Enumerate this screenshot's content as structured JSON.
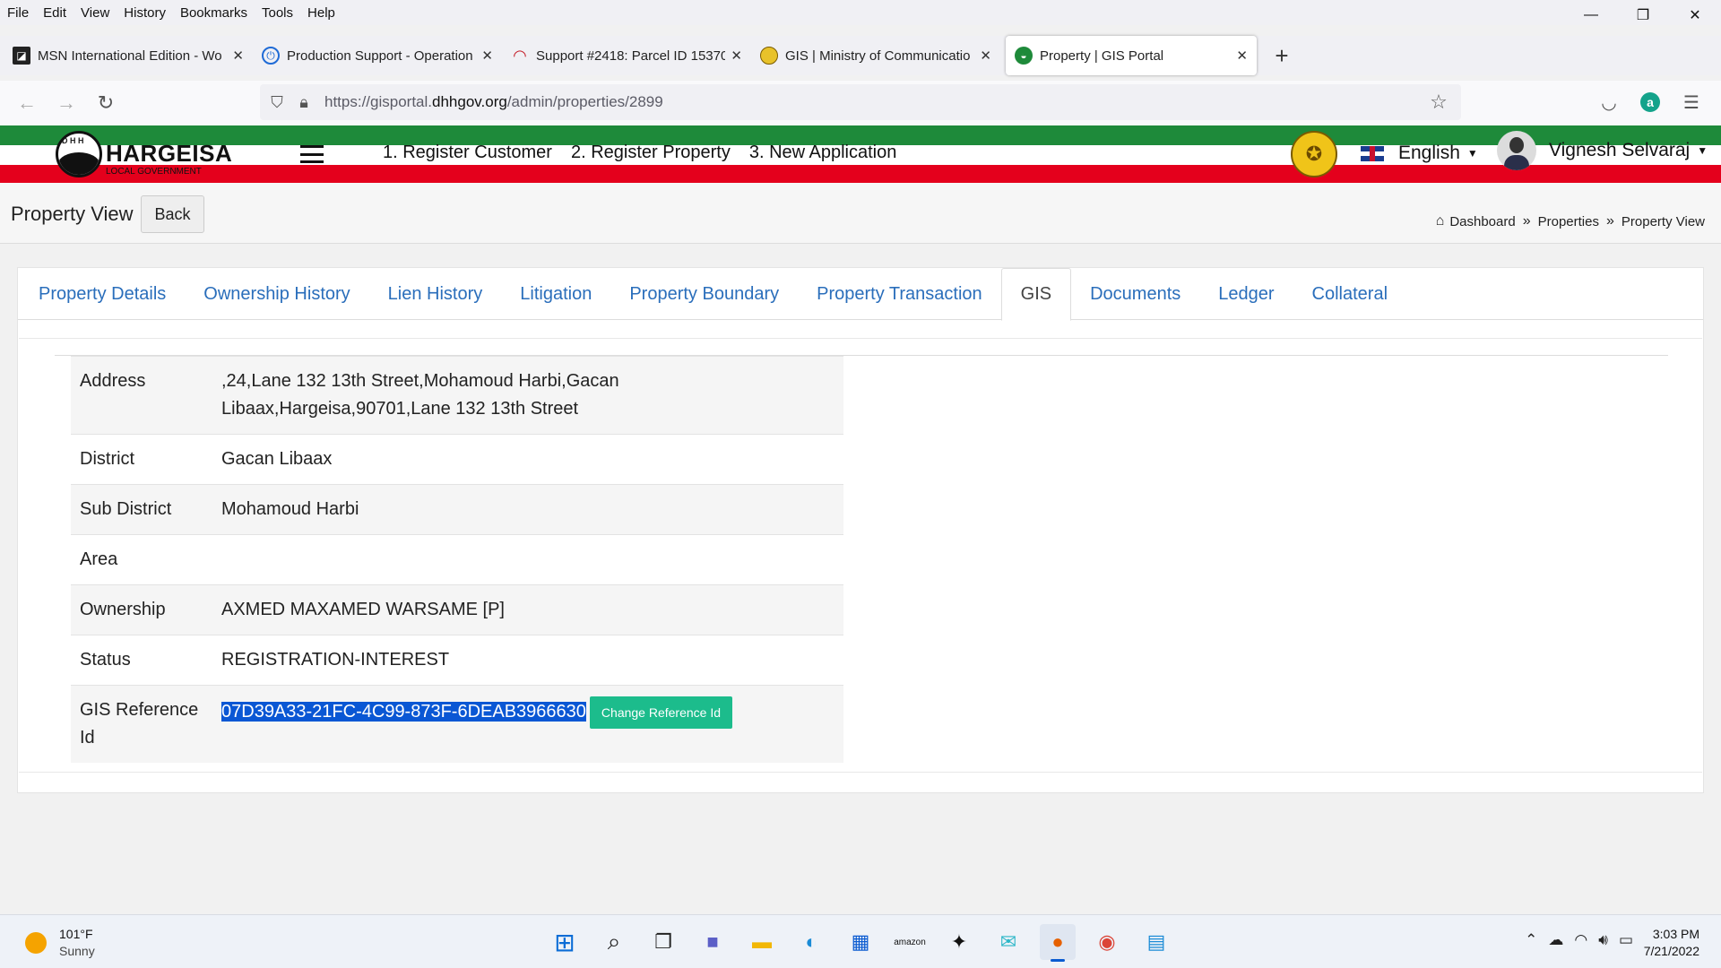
{
  "browser": {
    "menu": [
      "File",
      "Edit",
      "View",
      "History",
      "Bookmarks",
      "Tools",
      "Help"
    ],
    "window_controls": {
      "minimize": "—",
      "restore": "❐",
      "close": "✕"
    },
    "tabs": [
      {
        "title": "MSN International Edition - Wo",
        "icon": "msn-icon",
        "color": "#222222"
      },
      {
        "title": "Production Support - Operation",
        "icon": "power-icon",
        "color": "#1f6bd6"
      },
      {
        "title": "Support #2418: Parcel ID 15370",
        "icon": "redmine-icon",
        "color": "#c5202b"
      },
      {
        "title": "GIS | Ministry of Communicatio",
        "icon": "emblem-icon",
        "color": "#c9a300"
      },
      {
        "title": "Property | GIS Portal",
        "icon": "portal-icon",
        "color": "#1e8a3a"
      }
    ],
    "url": {
      "prefix": "https://gisportal.",
      "host": "dhhgov.org",
      "path": "/admin/properties/2899"
    }
  },
  "site": {
    "logo_name": "HARGEISA",
    "logo_sub": "LOCAL GOVERNMENT",
    "logo_seal_text": "D H H",
    "nav": [
      "1. Register Customer",
      "2. Register Property",
      "3. New Application"
    ],
    "language": "English",
    "user": "Vignesh Selvaraj"
  },
  "page": {
    "title": "Property View",
    "back_label": "Back",
    "breadcrumbs": [
      "Dashboard",
      "Properties",
      "Property View"
    ],
    "breadcrumb_sep": "»"
  },
  "tabs": [
    "Property Details",
    "Ownership History",
    "Lien History",
    "Litigation",
    "Property Boundary",
    "Property Transaction",
    "GIS",
    "Documents",
    "Ledger",
    "Collateral"
  ],
  "active_tab": "GIS",
  "gis": {
    "address_label": "Address",
    "address_line1": ",24,Lane 132 13th Street,Mohamoud Harbi,Gacan",
    "address_line2": "Libaax,Hargeisa,90701,Lane 132 13th Street",
    "district_label": "District",
    "district": "Gacan Libaax",
    "subdistrict_label": "Sub District",
    "subdistrict": "Mohamoud Harbi",
    "area_label": "Area",
    "area": "",
    "ownership_label": "Ownership",
    "ownership": "AXMED MAXAMED WARSAME [P]",
    "status_label": "Status",
    "status": "REGISTRATION-INTEREST",
    "ref_label_1": "GIS Reference",
    "ref_label_2": "Id",
    "ref_id": "07D39A33-21FC-4C99-873F-6DEAB3966630",
    "change_ref_label": "Change Reference Id"
  },
  "taskbar": {
    "temp": "101°F",
    "condition": "Sunny",
    "time": "3:03 PM",
    "date": "7/21/2022"
  },
  "colors": {
    "green_stripe": "#1e8a3a",
    "red_stripe": "#e4001c",
    "link": "#2a6ebb",
    "button_green": "#1cbc8c",
    "selection": "#0a57d4"
  }
}
